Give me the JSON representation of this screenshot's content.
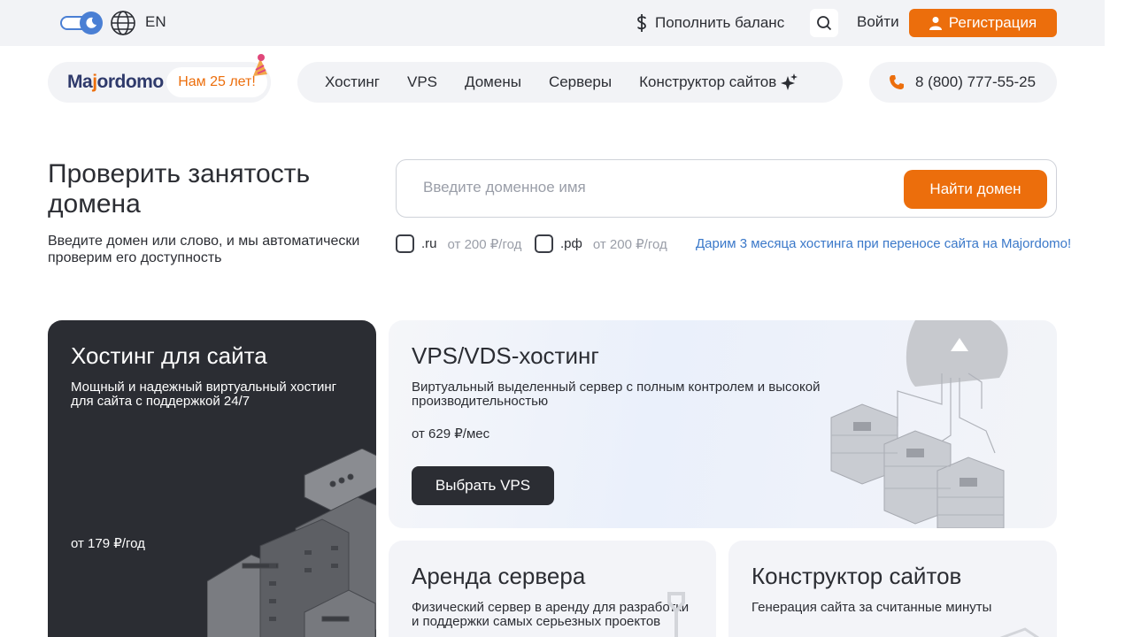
{
  "topbar": {
    "lang": "EN",
    "topup_label": "Пополнить баланс",
    "login_label": "Войти",
    "register_label": "Регистрация"
  },
  "header": {
    "logo_prefix": "Ma",
    "logo_accent": "j",
    "logo_suffix": "ordomo",
    "anniversary": "Нам 25 лет!",
    "nav": [
      "Хостинг",
      "VPS",
      "Домены",
      "Серверы",
      "Конструктор сайтов"
    ],
    "phone": "8 (800) 777-55-25"
  },
  "domain_check": {
    "title": "Проверить занятость домена",
    "subtitle": "Введите домен или слово, и мы автоматически проверим его доступность",
    "placeholder": "Введите доменное имя",
    "button": "Найти домен",
    "zones": [
      {
        "name": ".ru",
        "price": "от 200 ₽/год",
        "checked": false
      },
      {
        "name": ".рф",
        "price": "от 200 ₽/год",
        "checked": false
      }
    ],
    "promo": "Дарим 3 месяца хостинга при переносе сайта на Majordomo!"
  },
  "cards": {
    "hosting": {
      "title": "Хостинг для сайта",
      "desc": "Мощный и надежный виртуальный хостинг для сайта с поддержкой 24/7",
      "price": "от 179 ₽/год"
    },
    "vps": {
      "title": "VPS/VDS-хостинг",
      "desc": "Виртуальный выделенный сервер с полным контролем и высокой производительностью",
      "price": "от 629 ₽/мес",
      "button": "Выбрать VPS"
    },
    "rent": {
      "title": "Аренда сервера",
      "desc": "Физический сервер в аренду для разработки и поддержки самых серьезных проектов"
    },
    "builder": {
      "title": "Конструктор сайтов",
      "desc": "Генерация сайта за считанные минуты"
    }
  },
  "icons": {
    "theme": "moon-icon",
    "language": "globe-icon",
    "balance": "dollar-icon",
    "search": "search-icon",
    "user": "user-icon",
    "sparkle": "sparkle-icon",
    "phone": "phone-icon"
  },
  "colors": {
    "accent": "#ec6e0c",
    "dark": "#2b2d33",
    "link": "#3a78c9",
    "toggle": "#4a7fd4"
  }
}
